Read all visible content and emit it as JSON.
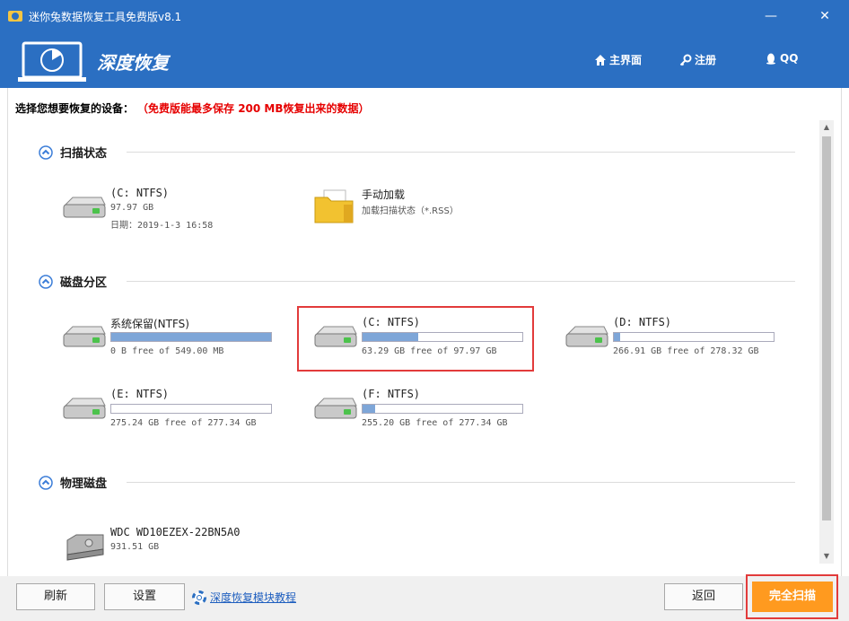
{
  "window": {
    "title": "迷你兔数据恢复工具免费版v8.1",
    "minimize": "—",
    "close": "✕"
  },
  "header": {
    "app_name": "深度恢复",
    "nav": {
      "home": "主界面",
      "register": "注册",
      "qq": "QQ"
    }
  },
  "instruction": {
    "text": "选择您想要恢复的设备：",
    "note": "（免费版能最多保存 200 MB恢复出来的数据）"
  },
  "sections": {
    "scan_state": {
      "title": "扫描状态",
      "items": [
        {
          "name": "(C: NTFS)",
          "size": "97.97 GB",
          "date": "日期：2019-1-3 16:58"
        },
        {
          "name": "手动加载",
          "desc": "加载扫描状态（*.RSS）"
        }
      ]
    },
    "partitions": {
      "title": "磁盘分区",
      "items": [
        {
          "name": "系统保留(NTFS)",
          "free": "0 B free of 549.00 MB",
          "used_fraction": 1.0
        },
        {
          "name": "(C: NTFS)",
          "free": "63.29 GB free of 97.97 GB",
          "used_fraction": 0.35
        },
        {
          "name": "(D: NTFS)",
          "free": "266.91 GB free of 278.32 GB",
          "used_fraction": 0.04
        },
        {
          "name": "(E: NTFS)",
          "free": "275.24 GB free of 277.34 GB",
          "used_fraction": 0.0
        },
        {
          "name": "(F: NTFS)",
          "free": "255.20 GB free of 277.34 GB",
          "used_fraction": 0.08
        }
      ]
    },
    "physical": {
      "title": "物理磁盘",
      "items": [
        {
          "name": "WDC WD10EZEX-22BN5A0",
          "size": "931.51 GB"
        }
      ]
    }
  },
  "footer": {
    "refresh": "刷新",
    "settings": "设置",
    "tutorial": "深度恢复模块教程",
    "back": "返回",
    "full_scan": "完全扫描"
  },
  "colors": {
    "brand_blue": "#2b6fc2",
    "accent_orange": "#ff9a1f",
    "highlight_red": "#e23b3b",
    "bar_fill": "#7ea6d8"
  }
}
